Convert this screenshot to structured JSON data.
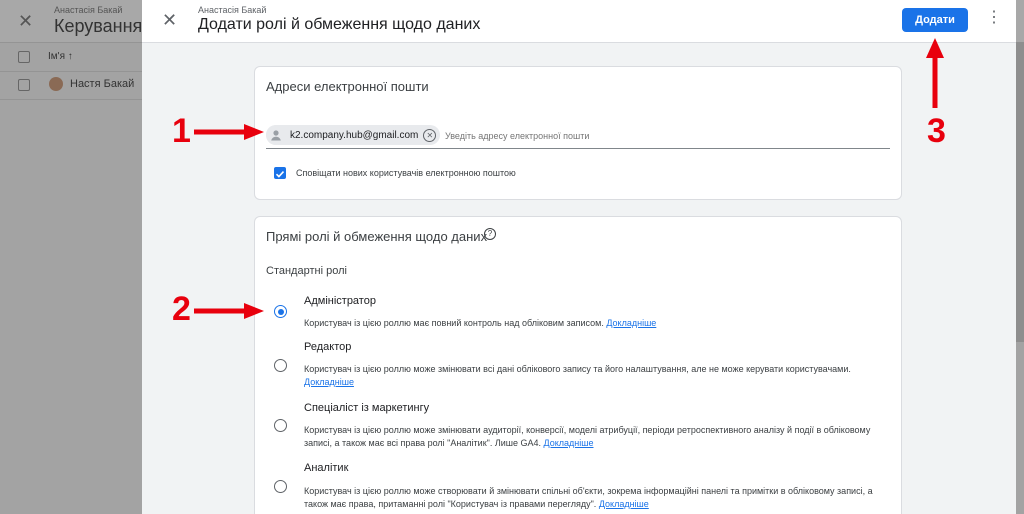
{
  "background": {
    "user": "Анастасія Бакай",
    "title": "Керування до",
    "column_header": "Ім'я ↑",
    "row_name": "Настя Бакай"
  },
  "dialog": {
    "user": "Анастасія Бакай",
    "title": "Додати ролі й обмеження щодо даних",
    "add_button": "Додати"
  },
  "emails_card": {
    "title": "Адреси електронної пошти",
    "chip_email": "k2.company.hub@gmail.com",
    "input_placeholder": "Уведіть адресу електронної пошти",
    "notify_label": "Сповіщати нових користувачів електронною поштою",
    "notify_checked": true
  },
  "roles_card": {
    "title": "Прямі ролі й обмеження щодо даних",
    "standard_roles": "Стандартні ролі",
    "learn_more": "Докладніше",
    "roles": [
      {
        "name": "Адміністратор",
        "desc": "Користувач із цією роллю має повний контроль над обліковим записом.",
        "selected": true
      },
      {
        "name": "Редактор",
        "desc": "Користувач із цією роллю може змінювати всі дані облікового запису та його налаштування, але не може керувати користувачами.",
        "selected": false
      },
      {
        "name": "Спеціаліст із маркетингу",
        "desc": "Користувач із цією роллю може змінювати аудиторії, конверсії, моделі атрибуції, періоди ретроспективного аналізу й події в обліковому записі, а також має всі права ролі \"Аналітик\". Лише GA4.",
        "selected": false
      },
      {
        "name": "Аналітик",
        "desc": "Користувач із цією роллю може створювати й змінювати спільні об'єкти, зокрема інформаційні панелі та примітки в обліковому записі, а також має права, притаманні ролі \"Користувач із правами перегляду\".",
        "selected": false
      }
    ]
  },
  "annotations": [
    "1",
    "2",
    "3"
  ],
  "colors": {
    "accent": "#1a73e8",
    "annotation": "#e8000d"
  }
}
